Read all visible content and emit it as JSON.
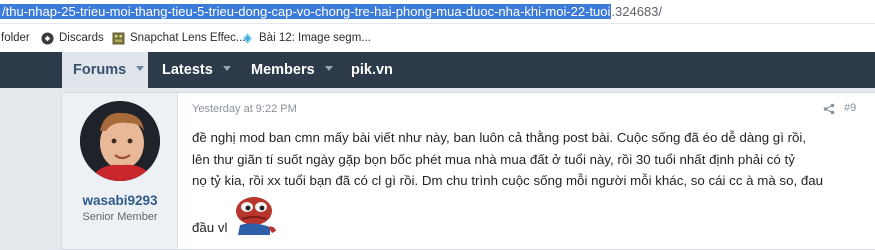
{
  "browser": {
    "url_selected": "/thu-nhap-25-trieu-moi-thang-tieu-5-trieu-dong-cap-vo-chong-tre-hai-phong-mua-duoc-nha-khi-moi-22-tuoi",
    "url_rest": ".324683/"
  },
  "bookmarks": [
    {
      "label": "folder",
      "icon": "folder-icon"
    },
    {
      "label": "Discards",
      "icon": "discards-icon"
    },
    {
      "label": "Snapchat Lens Effec...",
      "icon": "snapchat-lens-icon"
    },
    {
      "label": "Bài 12: Image segm...",
      "icon": "lesson-icon"
    }
  ],
  "nav": {
    "items": [
      {
        "label": "Forums",
        "active": true
      },
      {
        "label": "Latests"
      },
      {
        "label": "Members"
      },
      {
        "label": "pik.vn"
      }
    ]
  },
  "post": {
    "username": "wasabi9293",
    "user_title": "Senior Member",
    "time": "Yesterday at 9:22 PM",
    "number": "#9",
    "lines": [
      "đề nghị mod ban cmn mấy bài viết như này, ban luôn cả thằng post bài. Cuộc sống đã éo dễ dàng gì rồi,",
      "lên thư giãn tí suốt ngày gặp bọn bốc phét mua nhà mua đất ở tuổi này, rồi 30 tuổi nhất định phải có tỷ",
      "nọ tỷ kia, rồi xx tuổi bạn đã có cl gì rồi. Dm chu trình cuộc sống mỗi người mỗi khác, so cái cc à mà so, đau"
    ],
    "last_line": "đầu vl",
    "emoji_icon": "pepe-emoji-icon"
  },
  "colors": {
    "nav_bg": "#2c3a4a",
    "username": "#2f5b8b",
    "url_highlight": "#3d7bd8"
  }
}
